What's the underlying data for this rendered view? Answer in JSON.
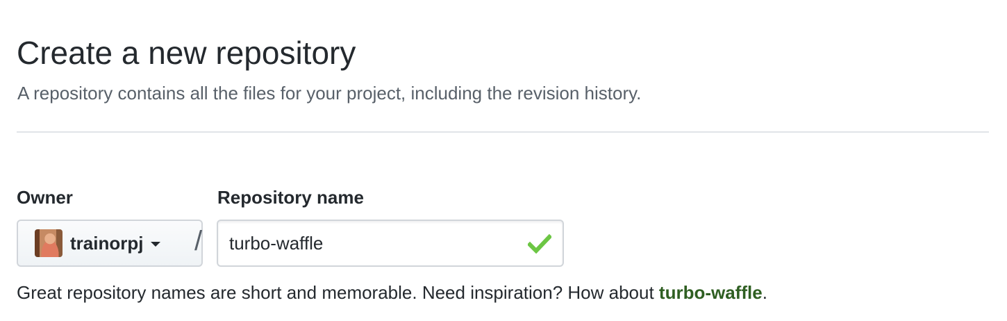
{
  "header": {
    "title": "Create a new repository",
    "subtitle": "A repository contains all the files for your project, including the revision history."
  },
  "owner": {
    "label": "Owner",
    "selected": "trainorpj",
    "avatar_icon": "user-avatar",
    "caret_icon": "caret-down-icon"
  },
  "separator": "/",
  "repository_name": {
    "label": "Repository name",
    "value": "turbo-waffle",
    "status_icon": "check-icon",
    "status_color": "#6cc644"
  },
  "hint": {
    "text": "Great repository names are short and memorable. Need inspiration? How about ",
    "suggestion": "turbo-waffle",
    "suffix": ".",
    "suggestion_color": "#2f5f22"
  }
}
